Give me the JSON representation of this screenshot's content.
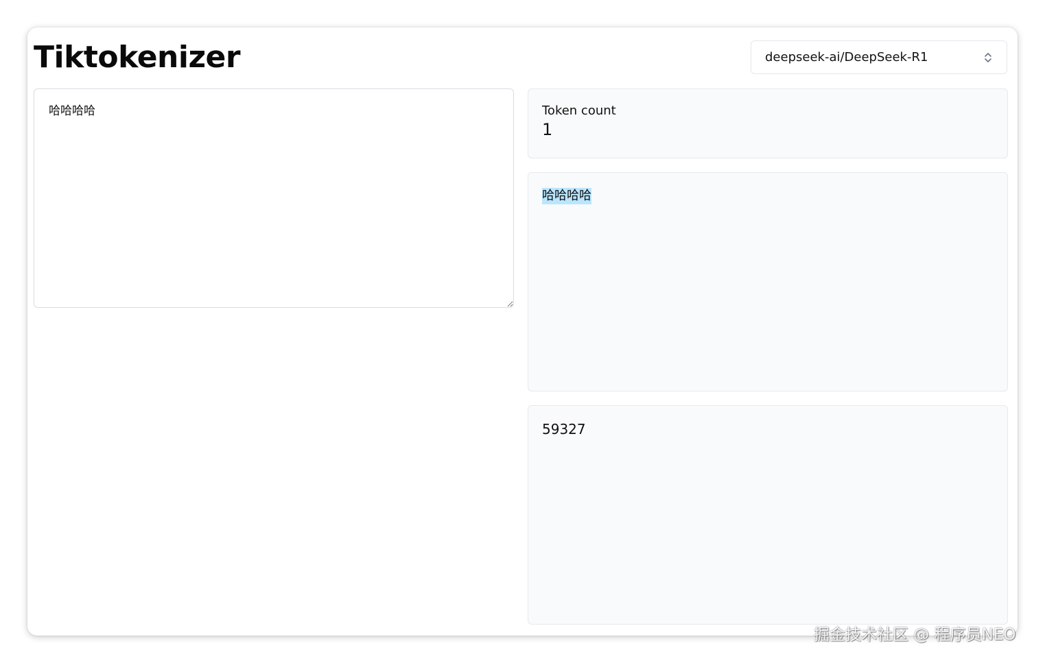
{
  "header": {
    "title": "Tiktokenizer",
    "model_select": {
      "selected": "deepseek-ai/DeepSeek-R1",
      "icon": "chevron-up-down-icon"
    }
  },
  "input": {
    "value": "哈哈哈哈"
  },
  "token_count": {
    "label": "Token count",
    "value": "1"
  },
  "tokens": [
    {
      "text": "哈哈哈哈",
      "highlight_color": "#bae6fd"
    }
  ],
  "token_ids": [
    "59327"
  ],
  "watermark": "掘金技术社区 @ 程序员NEO"
}
